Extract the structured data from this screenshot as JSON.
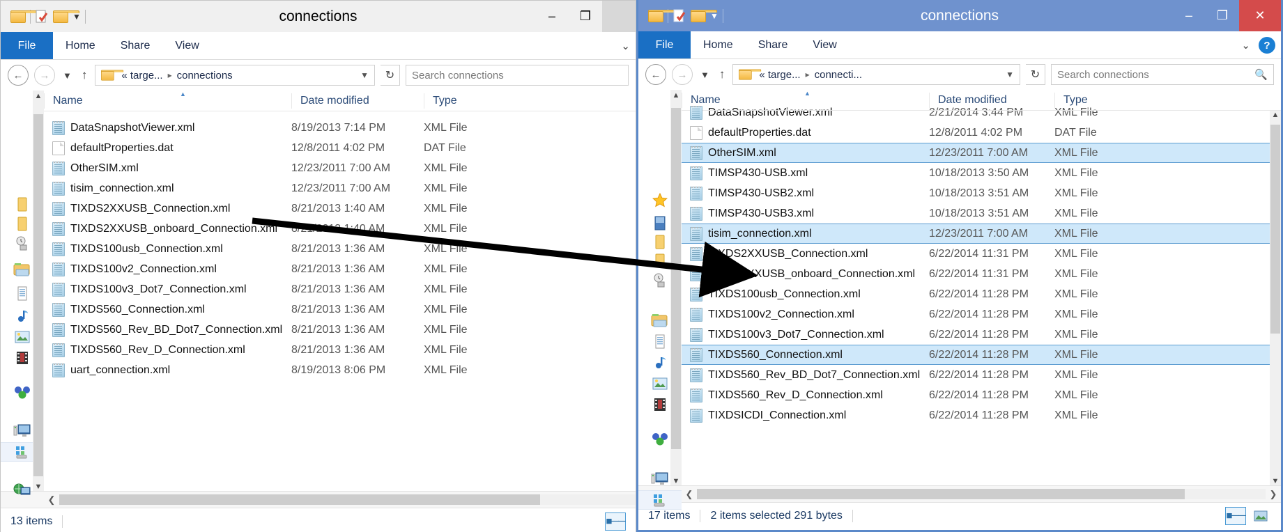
{
  "left_window": {
    "title": "connections",
    "quick_access": [
      "folder-icon",
      "properties-icon",
      "new-folder-icon",
      "dropdown-caret"
    ],
    "window_buttons": {
      "minimize": "–",
      "maximize": "❐",
      "close": ""
    },
    "ribbon_tabs": [
      {
        "label": "File",
        "active": true
      },
      {
        "label": "Home",
        "active": false
      },
      {
        "label": "Share",
        "active": false
      },
      {
        "label": "View",
        "active": false
      }
    ],
    "address": {
      "crumb1": "« targe...",
      "crumb2": "connections",
      "separator": "▸"
    },
    "search": {
      "placeholder": "Search connections",
      "value": ""
    },
    "columns": [
      {
        "label": "Name",
        "sorted": true
      },
      {
        "label": "Date modified",
        "sorted": false
      },
      {
        "label": "Type",
        "sorted": false
      }
    ],
    "rows": [
      {
        "name": "DataSnapshotViewer.xml",
        "date": "8/19/2013 7:14 PM",
        "type": "XML File",
        "icon": "xml-file-icon",
        "selected": false
      },
      {
        "name": "defaultProperties.dat",
        "date": "12/8/2011 4:02 PM",
        "type": "DAT File",
        "icon": "dat-file-icon",
        "selected": false
      },
      {
        "name": "OtherSIM.xml",
        "date": "12/23/2011 7:00 AM",
        "type": "XML File",
        "icon": "xml-file-icon",
        "selected": false
      },
      {
        "name": "tisim_connection.xml",
        "date": "12/23/2011 7:00 AM",
        "type": "XML File",
        "icon": "xml-file-icon",
        "selected": false
      },
      {
        "name": "TIXDS2XXUSB_Connection.xml",
        "date": "8/21/2013 1:40 AM",
        "type": "XML File",
        "icon": "xml-file-icon",
        "selected": false
      },
      {
        "name": "TIXDS2XXUSB_onboard_Connection.xml",
        "date": "8/21/2013 1:40 AM",
        "type": "XML File",
        "icon": "xml-file-icon",
        "selected": false
      },
      {
        "name": "TIXDS100usb_Connection.xml",
        "date": "8/21/2013 1:36 AM",
        "type": "XML File",
        "icon": "xml-file-icon",
        "selected": false
      },
      {
        "name": "TIXDS100v2_Connection.xml",
        "date": "8/21/2013 1:36 AM",
        "type": "XML File",
        "icon": "xml-file-icon",
        "selected": false
      },
      {
        "name": "TIXDS100v3_Dot7_Connection.xml",
        "date": "8/21/2013 1:36 AM",
        "type": "XML File",
        "icon": "xml-file-icon",
        "selected": false
      },
      {
        "name": "TIXDS560_Connection.xml",
        "date": "8/21/2013 1:36 AM",
        "type": "XML File",
        "icon": "xml-file-icon",
        "selected": false
      },
      {
        "name": "TIXDS560_Rev_BD_Dot7_Connection.xml",
        "date": "8/21/2013 1:36 AM",
        "type": "XML File",
        "icon": "xml-file-icon",
        "selected": false
      },
      {
        "name": "TIXDS560_Rev_D_Connection.xml",
        "date": "8/21/2013 1:36 AM",
        "type": "XML File",
        "icon": "xml-file-icon",
        "selected": false
      },
      {
        "name": "uart_connection.xml",
        "date": "8/19/2013 8:06 PM",
        "type": "XML File",
        "icon": "xml-file-icon",
        "selected": false
      }
    ],
    "nav_icons": [
      "folder-icon",
      "folder-icon",
      "recent-places-icon",
      "libraries-folder-icon",
      "documents-library-icon",
      "music-library-icon",
      "pictures-library-icon",
      "videos-library-icon",
      "homegroup-icon",
      "computer-icon",
      "local-disk-icon",
      "network-icon"
    ],
    "status": {
      "items": "13 items",
      "selection": ""
    }
  },
  "right_window": {
    "title": "connections",
    "quick_access": [
      "folder-icon",
      "properties-icon",
      "new-folder-icon",
      "dropdown-caret"
    ],
    "window_buttons": {
      "minimize": "–",
      "maximize": "❐",
      "close": "✕"
    },
    "ribbon_tabs": [
      {
        "label": "File",
        "active": true
      },
      {
        "label": "Home",
        "active": false
      },
      {
        "label": "Share",
        "active": false
      },
      {
        "label": "View",
        "active": false
      }
    ],
    "ribbon_right": {
      "chevron": "⌄",
      "help": "?"
    },
    "address": {
      "crumb1": "« targe...",
      "crumb2": "connecti...",
      "separator": "▸"
    },
    "search": {
      "placeholder": "Search connections",
      "value": ""
    },
    "columns": [
      {
        "label": "Name",
        "sorted": true
      },
      {
        "label": "Date modified",
        "sorted": false
      },
      {
        "label": "Type",
        "sorted": false
      }
    ],
    "rows": [
      {
        "name": "DataSnapshotViewer.xml",
        "date": "2/21/2014 3:44 PM",
        "type": "XML File",
        "icon": "xml-file-icon",
        "selected": false,
        "clipped": "top"
      },
      {
        "name": "defaultProperties.dat",
        "date": "12/8/2011 4:02 PM",
        "type": "DAT File",
        "icon": "dat-file-icon",
        "selected": false
      },
      {
        "name": "OtherSIM.xml",
        "date": "12/23/2011 7:00 AM",
        "type": "XML File",
        "icon": "xml-file-icon",
        "selected": true
      },
      {
        "name": "TIMSP430-USB.xml",
        "date": "10/18/2013 3:50 AM",
        "type": "XML File",
        "icon": "xml-file-icon",
        "selected": false
      },
      {
        "name": "TIMSP430-USB2.xml",
        "date": "10/18/2013 3:51 AM",
        "type": "XML File",
        "icon": "xml-file-icon",
        "selected": false
      },
      {
        "name": "TIMSP430-USB3.xml",
        "date": "10/18/2013 3:51 AM",
        "type": "XML File",
        "icon": "xml-file-icon",
        "selected": false
      },
      {
        "name": "tisim_connection.xml",
        "date": "12/23/2011 7:00 AM",
        "type": "XML File",
        "icon": "xml-file-icon",
        "selected": true
      },
      {
        "name": "TIXDS2XXUSB_Connection.xml",
        "date": "6/22/2014 11:31 PM",
        "type": "XML File",
        "icon": "xml-file-icon",
        "selected": false
      },
      {
        "name": "TIXDS2XXUSB_onboard_Connection.xml",
        "date": "6/22/2014 11:31 PM",
        "type": "XML File",
        "icon": "xml-file-icon",
        "selected": false
      },
      {
        "name": "TIXDS100usb_Connection.xml",
        "date": "6/22/2014 11:28 PM",
        "type": "XML File",
        "icon": "xml-file-icon",
        "selected": false
      },
      {
        "name": "TIXDS100v2_Connection.xml",
        "date": "6/22/2014 11:28 PM",
        "type": "XML File",
        "icon": "xml-file-icon",
        "selected": false
      },
      {
        "name": "TIXDS100v3_Dot7_Connection.xml",
        "date": "6/22/2014 11:28 PM",
        "type": "XML File",
        "icon": "xml-file-icon",
        "selected": false
      },
      {
        "name": "TIXDS560_Connection.xml",
        "date": "6/22/2014 11:28 PM",
        "type": "XML File",
        "icon": "xml-file-icon",
        "selected": true
      },
      {
        "name": "TIXDS560_Rev_BD_Dot7_Connection.xml",
        "date": "6/22/2014 11:28 PM",
        "type": "XML File",
        "icon": "xml-file-icon",
        "selected": false
      },
      {
        "name": "TIXDS560_Rev_D_Connection.xml",
        "date": "6/22/2014 11:28 PM",
        "type": "XML File",
        "icon": "xml-file-icon",
        "selected": false
      },
      {
        "name": "TIXDSICDI_Connection.xml",
        "date": "6/22/2014 11:28 PM",
        "type": "XML File",
        "icon": "xml-file-icon",
        "selected": false,
        "clipped": "bottom"
      }
    ],
    "nav_icons": [
      "favorites-star-icon",
      "desktop-icon",
      "downloads-folder-icon",
      "folder-icon",
      "recent-places-icon",
      "libraries-folder-icon",
      "documents-library-icon",
      "music-library-icon",
      "pictures-library-icon",
      "videos-library-icon",
      "homegroup-icon",
      "computer-icon",
      "local-disk-icon"
    ],
    "status": {
      "items": "17 items",
      "selection": "2 items selected  291 bytes"
    }
  },
  "annotation": {
    "type": "arrow",
    "color": "#000000",
    "from_label": "tisim_connection.xml (left window)",
    "to_label": "tisim_connection.xml (right window)"
  },
  "colors": {
    "active_title_bar": "#6f92ce",
    "inactive_title_bar": "#f0f0f0",
    "file_tab_blue": "#1a6fc4",
    "close_button_red": "#d44b4b",
    "selection_blue": "#cfe8fa",
    "selection_border": "#5a9bd0",
    "window_border_active": "#5b89c9"
  }
}
